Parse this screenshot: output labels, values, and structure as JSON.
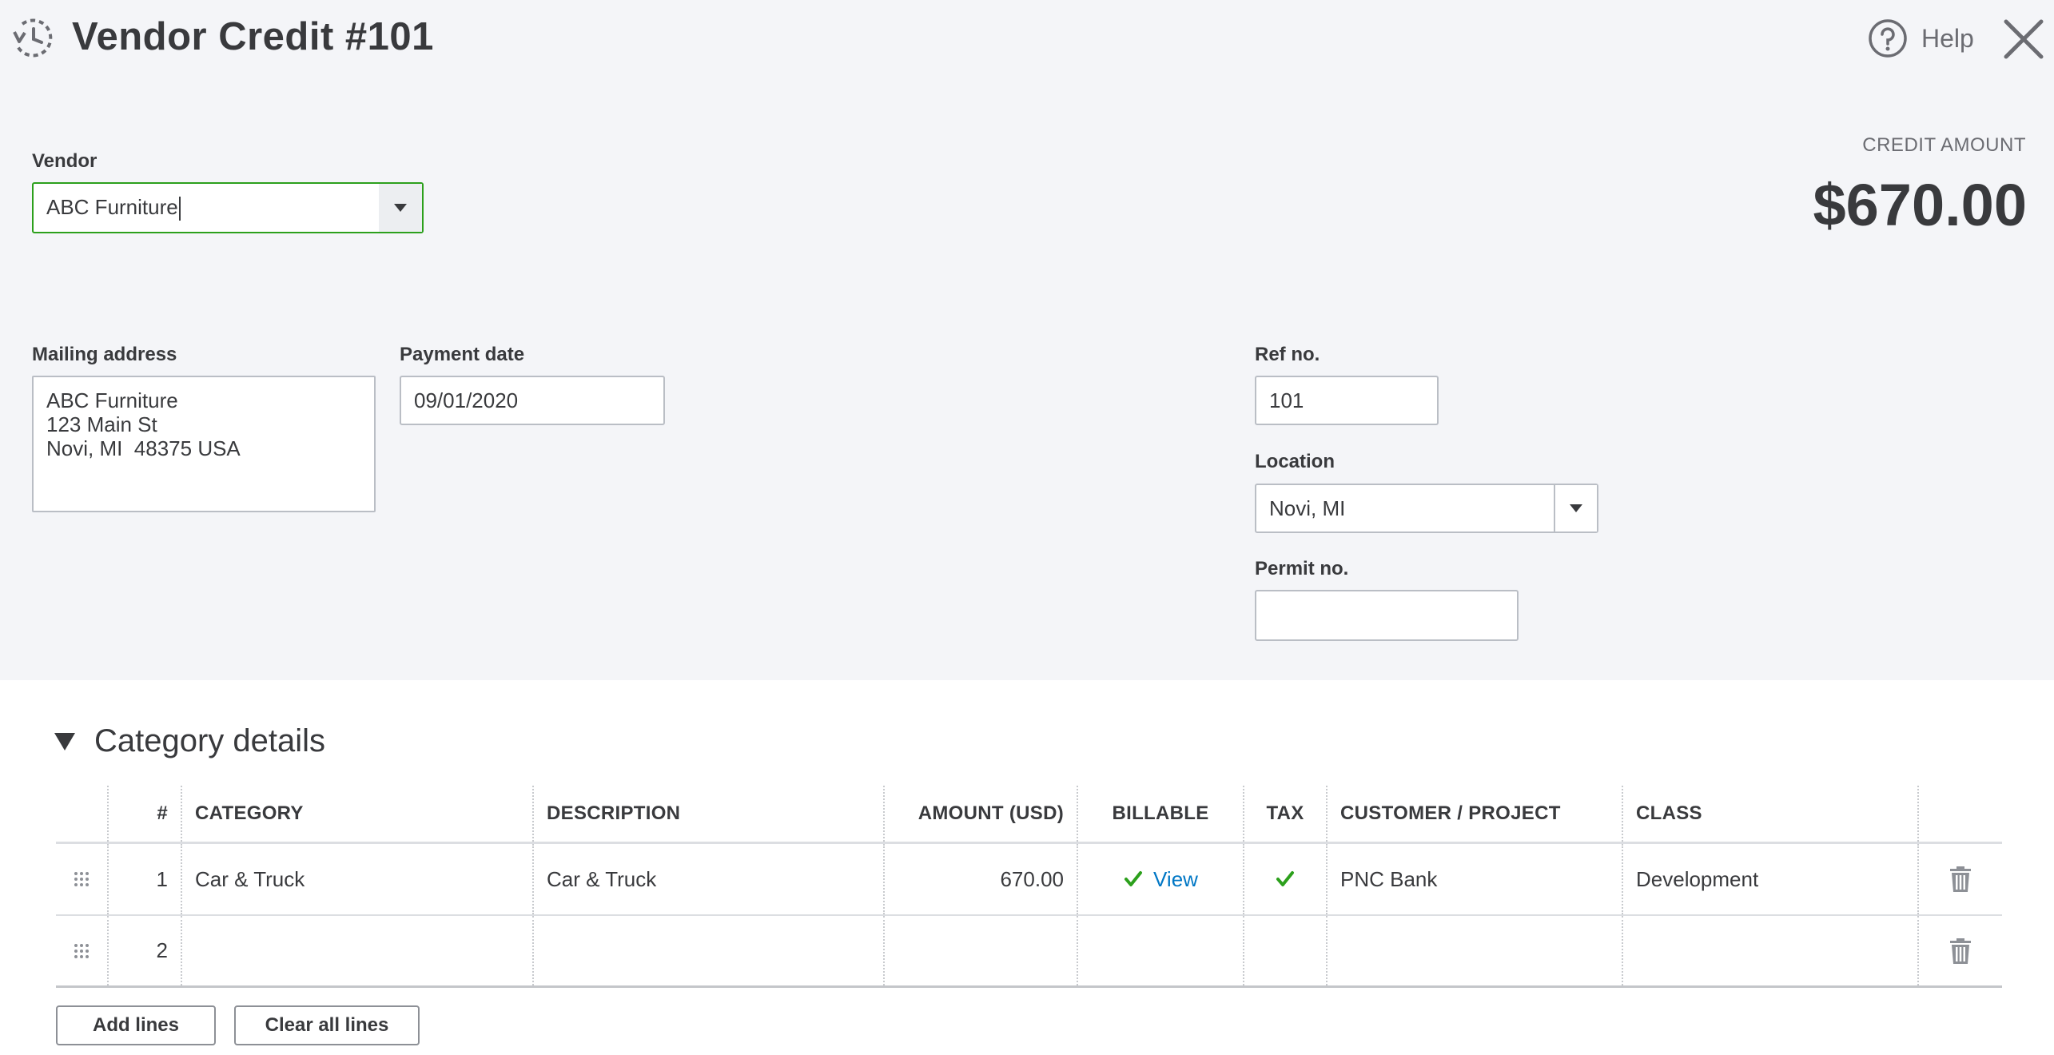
{
  "header": {
    "title": "Vendor Credit #101",
    "help_label": "Help"
  },
  "vendor": {
    "label": "Vendor",
    "value": "ABC Furniture"
  },
  "credit": {
    "label": "CREDIT AMOUNT",
    "amount": "$670.00"
  },
  "mailing_address": {
    "label": "Mailing address",
    "lines": [
      "ABC Furniture",
      "123 Main St",
      "Novi, MI  48375 USA"
    ]
  },
  "payment_date": {
    "label": "Payment date",
    "value": "09/01/2020"
  },
  "ref_no": {
    "label": "Ref no.",
    "value": "101"
  },
  "location": {
    "label": "Location",
    "value": "Novi, MI"
  },
  "permit_no": {
    "label": "Permit no.",
    "value": ""
  },
  "category_details": {
    "title": "Category details",
    "columns": {
      "num": "#",
      "category": "CATEGORY",
      "description": "DESCRIPTION",
      "amount": "AMOUNT (USD)",
      "billable": "BILLABLE",
      "tax": "TAX",
      "customer": "CUSTOMER / PROJECT",
      "class": "CLASS"
    },
    "rows": [
      {
        "num": "1",
        "category": "Car & Truck",
        "description": "Car & Truck",
        "amount": "670.00",
        "billable_link": "View",
        "customer": "PNC Bank",
        "class": "Development"
      },
      {
        "num": "2",
        "category": "",
        "description": "",
        "amount": "",
        "billable_link": "",
        "customer": "",
        "class": ""
      }
    ]
  },
  "buttons": {
    "add_lines": "Add lines",
    "clear_all_lines": "Clear all lines"
  },
  "colors": {
    "accent_green": "#2ca01c",
    "link_blue": "#0077c5",
    "background_gray": "#f4f5f8"
  },
  "icons": [
    "history-icon",
    "help-icon",
    "close-icon",
    "chevron-down-icon",
    "drag-handle-icon",
    "checkmark-icon",
    "trash-icon",
    "collapse-triangle-icon"
  ]
}
